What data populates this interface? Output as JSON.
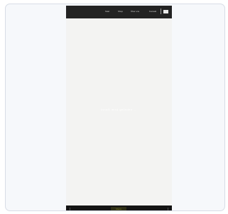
{
  "topbar": {
    "nav": [
      "Start",
      "Shop",
      "Über uns",
      "Kontakt"
    ],
    "flag_icon": "flag-icon"
  },
  "content": {
    "center_text": "Inhalt wird geladen …"
  },
  "bottombar": {
    "badge": "Menü",
    "left_icon": "chevron-left-icon",
    "right_icon": "chevron-right-icon"
  },
  "colors": {
    "page_bg": "#f6f8fb",
    "phone_bg": "#f3f3f2",
    "topbar_bg": "#232323",
    "bottombar_bg": "#141414",
    "badge_accent": "#8a8a30"
  }
}
